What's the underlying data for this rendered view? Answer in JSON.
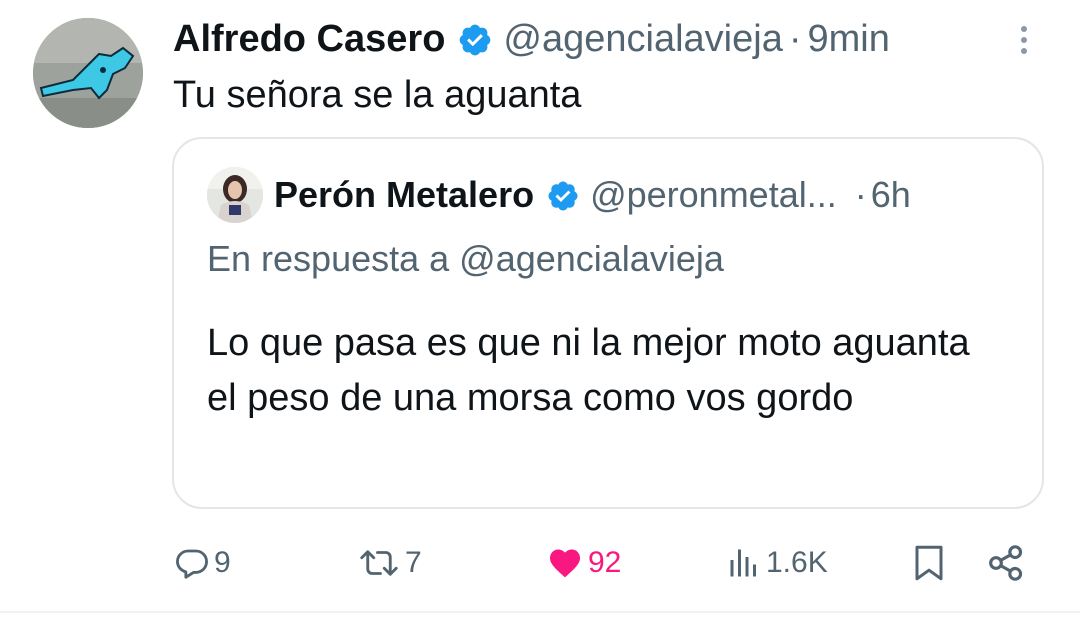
{
  "tweet": {
    "author_name": "Alfredo Casero",
    "author_handle": "@agencialavieja",
    "separator": "·",
    "time": "9min",
    "text": "Tu señora se la aguanta"
  },
  "quoted": {
    "author_name": "Perón Metalero",
    "author_handle": "@peronmetal...",
    "separator": "·",
    "time": "6h",
    "reply_to": "En respuesta a @agencialavieja",
    "text": "Lo que pasa es que ni la mejor moto aguanta el peso de una morsa como vos gordo"
  },
  "actions": {
    "replies": "9",
    "retweets": "7",
    "likes": "92",
    "views": "1.6K"
  },
  "colors": {
    "verified": "#1d9bf0",
    "like": "#f91880",
    "secondary_text": "#536471"
  },
  "icons": {
    "verified": "verified-badge-icon",
    "more": "more-options-icon",
    "reply": "reply-icon",
    "retweet": "retweet-icon",
    "like": "heart-icon",
    "views": "views-icon",
    "bookmark": "bookmark-icon",
    "share": "share-icon"
  }
}
